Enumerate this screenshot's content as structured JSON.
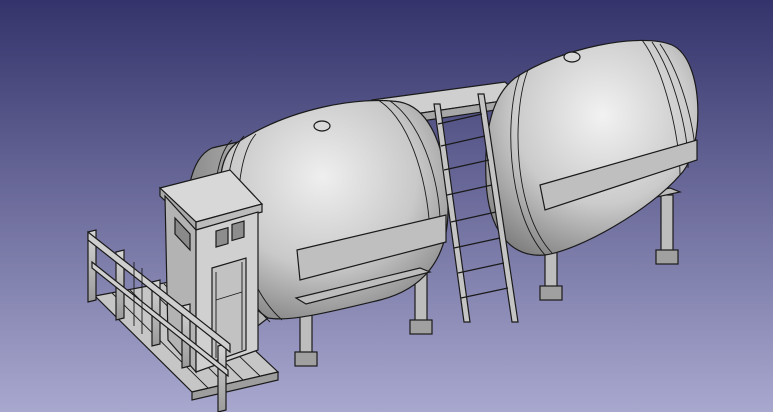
{
  "viewport": {
    "background_top": "#34336b",
    "background_bottom": "#a8a8cf",
    "model_base_color": "#c8c8c8",
    "model_shadow_color": "#7a7a7a",
    "edge_color": "#1a1a1a"
  },
  "model": {
    "parts": [
      "tank-left",
      "tank-right",
      "ladder",
      "shed",
      "fence",
      "deck",
      "walkway"
    ]
  }
}
